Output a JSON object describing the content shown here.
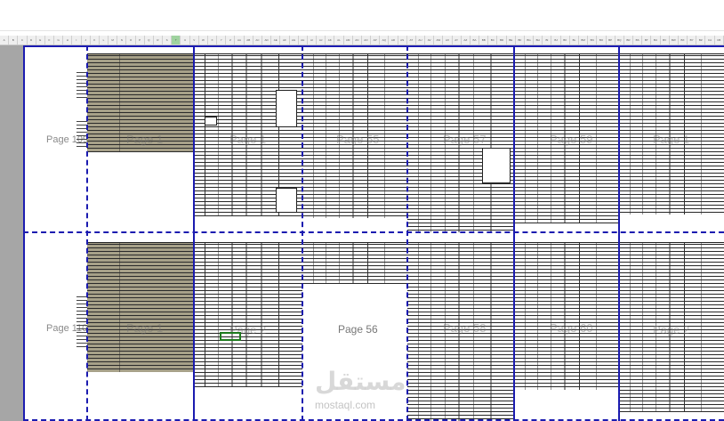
{
  "ruler": {
    "columns": [
      "A",
      "B",
      "C",
      "D",
      "E",
      "F",
      "G",
      "H",
      "I",
      "J",
      "K",
      "L",
      "M",
      "N",
      "O",
      "P",
      "Q",
      "R",
      "S",
      "T",
      "U",
      "V",
      "W",
      "X",
      "Y",
      "Z",
      "AA",
      "AB",
      "AC",
      "AD",
      "AE",
      "AF",
      "AG",
      "AH",
      "AI",
      "AJ",
      "AK",
      "AL",
      "AM",
      "AN",
      "AO",
      "AP",
      "AQ",
      "AR",
      "AS",
      "AT",
      "AU",
      "AV",
      "AW",
      "AX",
      "AY",
      "AZ",
      "BA",
      "BB",
      "BC",
      "BD",
      "BE",
      "BF",
      "BG",
      "BH",
      "BI",
      "BJ",
      "BK",
      "BL",
      "BM",
      "BN",
      "BO",
      "BP",
      "BQ",
      "BR",
      "BS",
      "BT",
      "BU",
      "BV",
      "BW",
      "BX",
      "BY",
      "BZ",
      "CA",
      "CB"
    ],
    "active_index": 19
  },
  "pages": {
    "p109": "Page 109",
    "p110": "Page 110",
    "p1a": "Page 1",
    "p1b": "Page 1",
    "p55": "Page 55",
    "p56": "Page 56",
    "p57": "Page 57",
    "p58": "Page 58",
    "p59": "Page 59",
    "p60": "Page 60",
    "p2a": "Page 2",
    "p2b": "Page 2"
  },
  "watermark": {
    "logo": "مستقل",
    "url": "mostaql.com"
  },
  "colors": {
    "page_break": "#1b1bb0",
    "gutter": "#a6a6a6",
    "olive_fill": "#a7a189",
    "selected_cell": "#1e7b1e"
  }
}
